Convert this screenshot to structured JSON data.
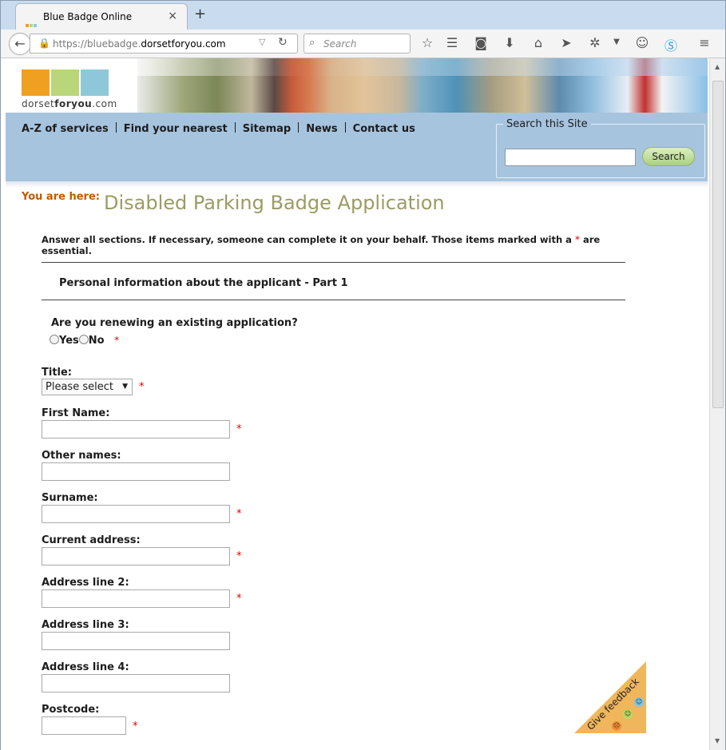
{
  "browser": {
    "tab_title": "Blue Badge Online",
    "tab_close": "×",
    "new_tab": "+",
    "url_prefix": "https://bluebadge.",
    "url_domain": "dorsetforyou.com",
    "search_placeholder": "Search"
  },
  "site": {
    "logo_text_1": "dorset",
    "logo_text_2": "foryou",
    "logo_text_3": ".com",
    "logo_colors": [
      "#f0a020",
      "#b9d77a",
      "#8ec8d8"
    ],
    "nav": [
      "A-Z of services",
      "Find your nearest",
      "Sitemap",
      "News",
      "Contact us"
    ],
    "search_legend": "Search this Site",
    "search_button": "Search"
  },
  "page": {
    "you_are_here": "You are here:",
    "title": "Disabled Parking Badge Application",
    "intro_1": "Answer all sections. If necessary, someone can complete it on your behalf. Those items marked with a ",
    "intro_star": "*",
    "intro_2": " are essential.",
    "section": "Personal information about the applicant - Part 1",
    "renew_question": "Are you renewing an existing application?",
    "yes": "Yes",
    "no": "No",
    "required_star": "*",
    "title_label": "Title:",
    "title_select": "Please select",
    "first_name": "First Name:",
    "other_names": "Other names:",
    "surname": "Surname:",
    "address_1": "Current address:",
    "address_2": "Address line 2:",
    "address_3": "Address line 3:",
    "address_4": "Address line 4:",
    "postcode": "Postcode:",
    "feedback": "Give feedback"
  }
}
